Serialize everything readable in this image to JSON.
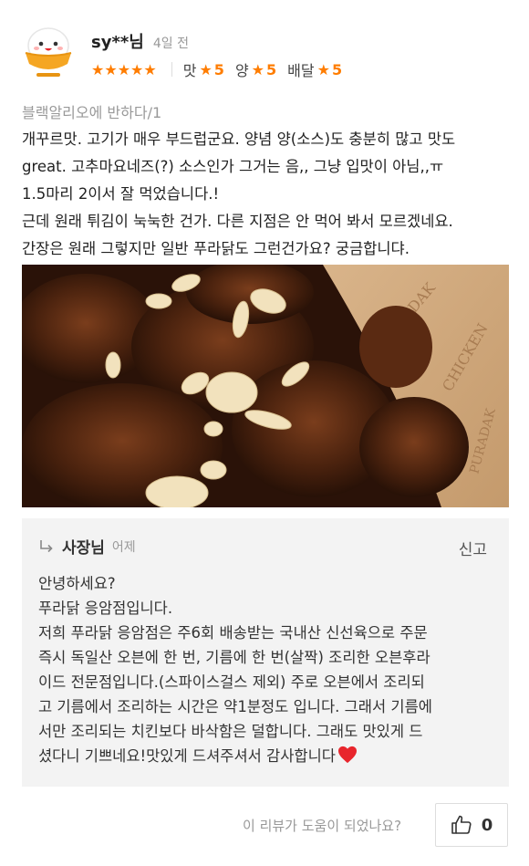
{
  "review": {
    "username": "sy**님",
    "time": "4일 전",
    "stars": "★★★★★",
    "sub_ratings": [
      {
        "label": "맛",
        "value": "5"
      },
      {
        "label": "양",
        "value": "5"
      },
      {
        "label": "배달",
        "value": "5"
      }
    ],
    "menu": "블랙알리오에 반하다/1",
    "lines": [
      "개꾸르맛. 고기가 매우 부드럽군요. 양념 양(소스)도 충분히 많고 맛도",
      "great. 고추마요네즈(?) 소스인가 그거는 음,, 그냥 입맛이 아님,,ㅠ",
      "1.5마리 2이서 잘 먹었습니다.!",
      "근데 원래 튀김이 눅눅한 건가. 다른 지점은 안 먹어 봐서 모르겠네요.",
      "간장은 원래 그렇지만 일반 푸라닭도 그런건가요? 궁금합니댜."
    ]
  },
  "reply": {
    "owner": "사장님",
    "time": "어제",
    "report_label": "신고",
    "lines": [
      "안녕하세요?",
      "푸라닭 응암점입니다.",
      "저희 푸라닭 응암점은 주6회 배송받는 국내산 신선육으로 주문",
      "즉시 독일산 오븐에 한 번, 기름에 한 번(살짝) 조리한 오븐후라",
      "이드 전문점입니다.(스파이스걸스 제외) 주로 오븐에서 조리되",
      "고 기름에서 조리하는 시간은 약1분정도 입니다. 그래서 기름에",
      "서만 조리되는 치킨보다 바삭함은 덜합니다. 그래도 맛있게 드",
      "셨다니 기쁘네요!맛있게 드셔주셔서 감사합니다"
    ]
  },
  "footer": {
    "helpful_text": "이 리뷰가 도움이 되었나요?",
    "like_count": "0"
  },
  "colors": {
    "accent": "#ff7d00",
    "reply_bg": "#f3f3f3",
    "heart": "#e8252c"
  }
}
